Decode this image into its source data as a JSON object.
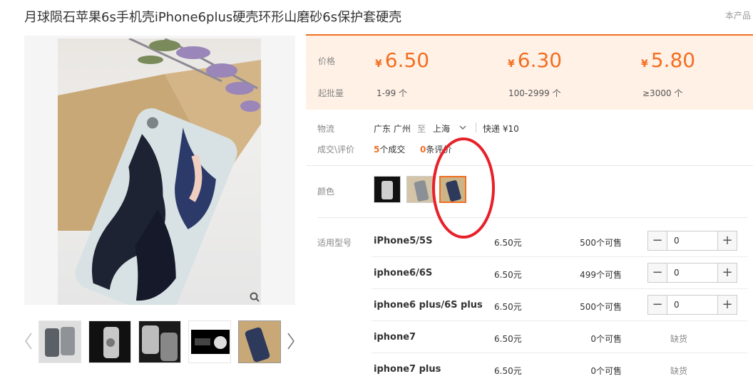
{
  "title": "月球陨石苹果6s手机壳iPhone6plus硬壳环形山磨砂6s保护套硬壳",
  "top_right": "本产品",
  "price_panel": {
    "price_label": "价格",
    "moq_label": "起批量",
    "tiers": [
      {
        "currency": "¥",
        "price": "6.50",
        "moq": "1-99 个"
      },
      {
        "currency": "¥",
        "price": "6.30",
        "moq": "100-2999 个"
      },
      {
        "currency": "¥",
        "price": "5.80",
        "moq": "≥3000 个"
      }
    ]
  },
  "logistics": {
    "label": "物流",
    "from": "广东 广州",
    "to_word": "至",
    "to": "上海",
    "shipping": "快递 ¥10"
  },
  "deals": {
    "label": "成交\\评价",
    "deal_count": "5",
    "deal_text": "个成交",
    "review_count": "0",
    "review_text": "条评价"
  },
  "color": {
    "label": "颜色",
    "selected_index": 2
  },
  "models": {
    "label": "适用型号",
    "rows": [
      {
        "name": "iPhone5/5S",
        "price": "6.50元",
        "stock": "500个可售",
        "qty": "0",
        "status": ""
      },
      {
        "name": "iphone6/6S",
        "price": "6.50元",
        "stock": "499个可售",
        "qty": "0",
        "status": ""
      },
      {
        "name": "iphone6 plus/6S plus",
        "price": "6.50元",
        "stock": "500个可售",
        "qty": "0",
        "status": ""
      },
      {
        "name": "iphone7",
        "price": "6.50元",
        "stock": "0个可售",
        "qty": "",
        "status": "缺货"
      },
      {
        "name": "iphone7 plus",
        "price": "6.50元",
        "stock": "0个可售",
        "qty": "",
        "status": "缺货"
      }
    ]
  },
  "colors": {
    "accent": "#f36e20",
    "panel_bg": "#fff1e6",
    "annotation": "#e8202a"
  }
}
